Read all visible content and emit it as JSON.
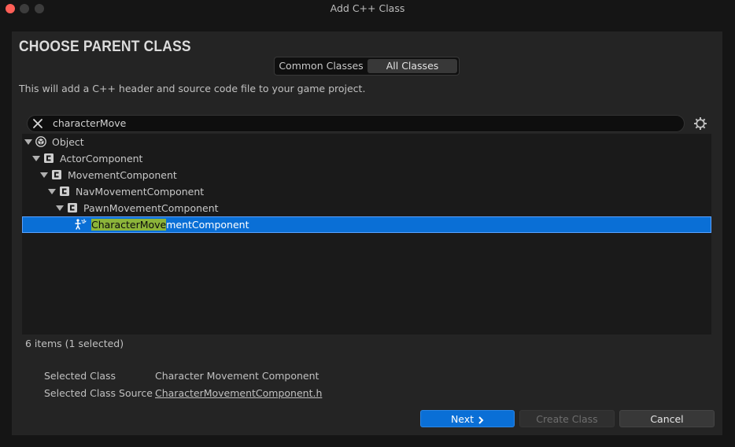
{
  "window": {
    "title": "Add C++ Class"
  },
  "header": {
    "heading": "CHOOSE PARENT CLASS",
    "tabs": [
      {
        "label": "Common Classes",
        "active": false
      },
      {
        "label": "All Classes",
        "active": true
      }
    ],
    "description": "This will add a C++ header and source code file to your game project."
  },
  "search": {
    "value": "characterMove"
  },
  "tree": {
    "items": [
      {
        "label": "Object",
        "icon": "object-icon",
        "expanded": true
      },
      {
        "label": "ActorComponent",
        "icon": "class-icon",
        "expanded": true
      },
      {
        "label": "MovementComponent",
        "icon": "class-icon",
        "expanded": true
      },
      {
        "label": "NavMovementComponent",
        "icon": "class-icon",
        "expanded": true
      },
      {
        "label": "PawnMovementComponent",
        "icon": "class-icon",
        "expanded": true
      },
      {
        "label": "CharacterMovementComponent",
        "match": "CharacterMove",
        "rest": "mentComponent",
        "icon": "character-movement-icon",
        "selected": true
      }
    ]
  },
  "status": "6 items (1 selected)",
  "info": {
    "selected_class_label": "Selected Class",
    "selected_class_value": "Character Movement Component",
    "selected_source_label": "Selected Class Source",
    "selected_source_value": "CharacterMovementComponent.h"
  },
  "buttons": {
    "next": "Next",
    "create": "Create Class",
    "cancel": "Cancel"
  },
  "colors": {
    "accent": "#0a6fd6",
    "highlight": "#8cb43a",
    "background": "#242424"
  }
}
